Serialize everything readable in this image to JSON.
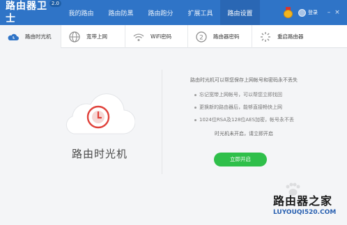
{
  "app": {
    "name": "路由器卫士",
    "version": "2.0"
  },
  "nav": [
    {
      "label": "我的路由",
      "active": false
    },
    {
      "label": "路由防黑",
      "active": false
    },
    {
      "label": "路由跑分",
      "active": false
    },
    {
      "label": "扩展工具",
      "active": false
    },
    {
      "label": "路由设置",
      "active": true
    }
  ],
  "topright": {
    "login_label": "登录",
    "minimize": "–",
    "close": "×"
  },
  "subtabs": [
    {
      "label": "路由时光机",
      "icon": "cloud-icon",
      "active": true
    },
    {
      "label": "宽带上网",
      "icon": "globe-icon",
      "active": false
    },
    {
      "label": "WiFi密码",
      "icon": "wifi-icon",
      "active": false
    },
    {
      "label": "路由器密码",
      "icon": "password-icon",
      "active": false
    },
    {
      "label": "重启路由器",
      "icon": "restart-icon",
      "active": false
    }
  ],
  "feature": {
    "title": "路由时光机",
    "description": "路由时光机可以帮您保存上网帐号和密码永不丢失",
    "bullets": [
      "忘记宽带上网帐号，可以帮您立即找回",
      "更换新的路由器后，能够直接畅快上网",
      "1024位RSA及128位AES加密，帐号永不丢"
    ],
    "status": "时光机未开启，请立即开启",
    "button": "立即开启"
  },
  "watermark": {
    "big": "路由器之家",
    "small": "LUYOUQI520.COM"
  },
  "colors": {
    "topbar": "#2f74c7",
    "accent_green": "#2fbf4a",
    "cloud_red": "#e0413a"
  }
}
